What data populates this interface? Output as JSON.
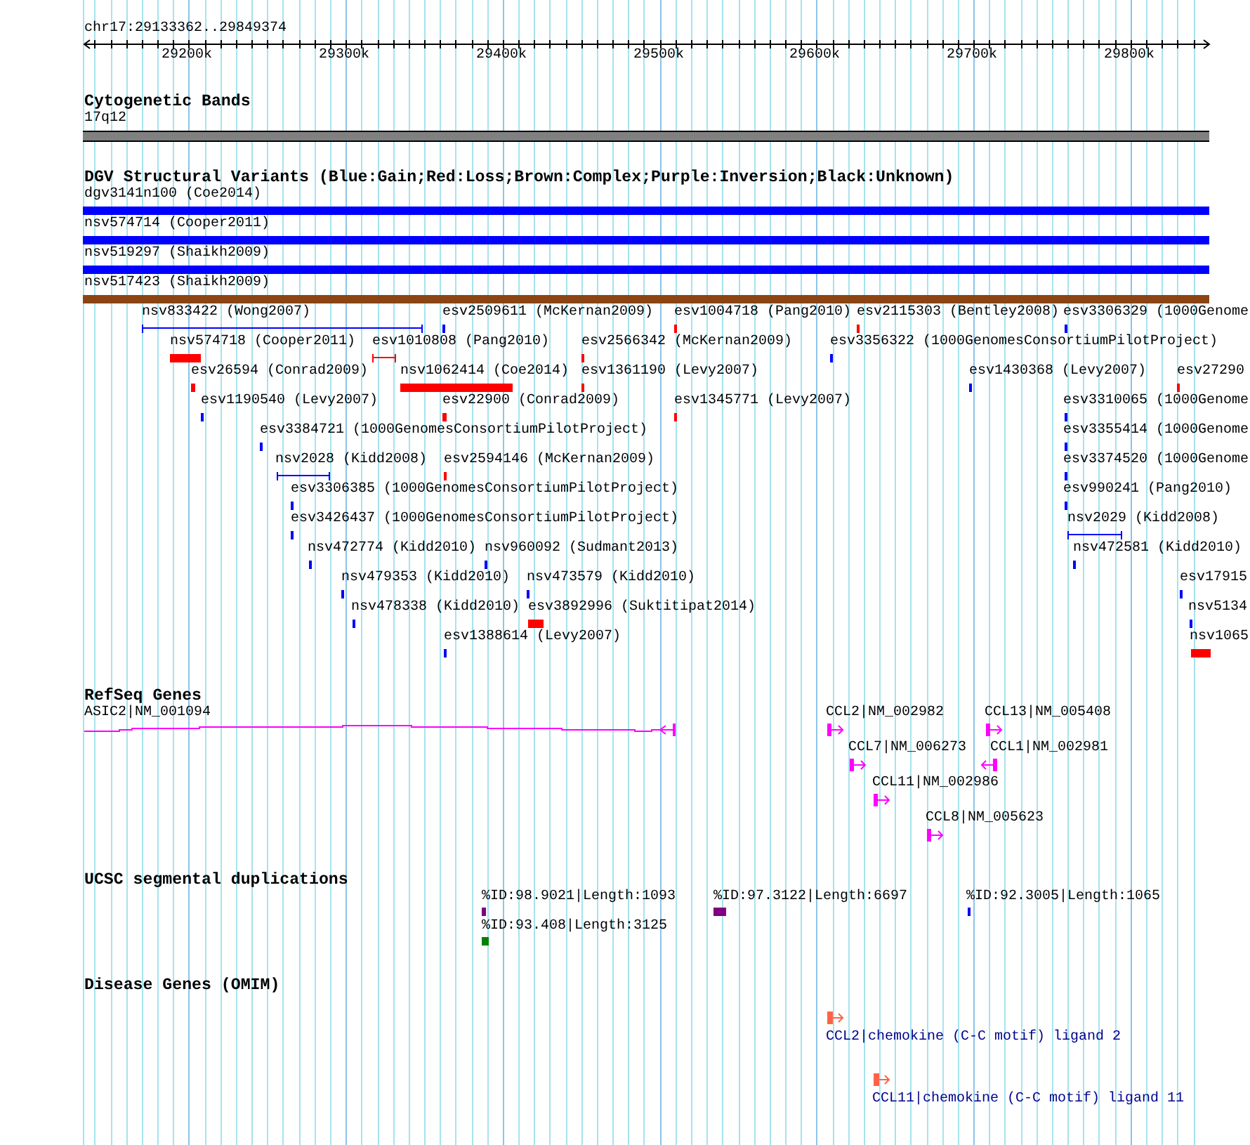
{
  "ruler": {
    "region": "chr17:29133362..29849374",
    "ticks": [
      "29200k",
      "29300k",
      "29400k",
      "29500k",
      "29600k",
      "29700k",
      "29800k"
    ]
  },
  "cytogenetic_bands": {
    "title": "Cytogenetic Bands",
    "bands": [
      {
        "label": "17q12"
      }
    ]
  },
  "structural_variants": {
    "title": "DGV Structural Variants (Blue:Gain;Red:Loss;Brown:Complex;Purple:Inversion;Black:Unknown)",
    "rows": [
      [
        {
          "label": "dgv3141n100 (Coe2014)",
          "kind": "bar",
          "color": "#0000ff"
        }
      ],
      [
        {
          "label": "nsv574714 (Cooper2011)",
          "kind": "bar",
          "color": "#0000ff"
        }
      ],
      [
        {
          "label": "nsv519297 (Shaikh2009)",
          "kind": "bar",
          "color": "#0000ff"
        }
      ],
      [
        {
          "label": "nsv517423 (Shaikh2009)",
          "kind": "bar",
          "color": "#8b4513"
        }
      ],
      [
        {
          "label": "nsv833422 (Wong2007)",
          "kind": "span",
          "color": "#0000ff"
        },
        {
          "label": "esv2509611 (McKernan2009)",
          "kind": "bar",
          "color": "#0000ff"
        },
        {
          "label": "esv1004718 (Pang2010)",
          "kind": "bar",
          "color": "#ff0000"
        },
        {
          "label": "esv2115303 (Bentley2008)",
          "kind": "bar",
          "color": "#ff0000"
        },
        {
          "label": "esv3306329 (1000Genome",
          "kind": "bar",
          "color": "#0000ff"
        }
      ],
      [
        {
          "label": "nsv574718 (Cooper2011)",
          "kind": "bar",
          "color": "#ff0000"
        },
        {
          "label": "esv1010808 (Pang2010)",
          "kind": "span",
          "color": "#ff0000"
        },
        {
          "label": "esv2566342 (McKernan2009)",
          "kind": "bar",
          "color": "#ff0000"
        },
        {
          "label": "esv3356322 (1000GenomesConsortiumPilotProject)",
          "kind": "bar",
          "color": "#0000ff"
        }
      ],
      [
        {
          "label": "esv26594 (Conrad2009)",
          "kind": "bar",
          "color": "#ff0000"
        },
        {
          "label": "nsv1062414 (Coe2014)",
          "kind": "bar",
          "color": "#ff0000"
        },
        {
          "label": "esv1361190 (Levy2007)",
          "kind": "bar",
          "color": "#ff0000"
        },
        {
          "label": "esv1430368 (Levy2007)",
          "kind": "bar",
          "color": "#0000ff"
        },
        {
          "label": "esv27290",
          "kind": "bar",
          "color": "#ff0000"
        }
      ],
      [
        {
          "label": "esv1190540 (Levy2007)",
          "kind": "bar",
          "color": "#0000ff"
        },
        {
          "label": "esv22900 (Conrad2009)",
          "kind": "bar",
          "color": "#ff0000"
        },
        {
          "label": "esv1345771 (Levy2007)",
          "kind": "bar",
          "color": "#ff0000"
        },
        {
          "label": "esv3310065 (1000Genome",
          "kind": "bar",
          "color": "#0000ff"
        }
      ],
      [
        {
          "label": "esv3384721 (1000GenomesConsortiumPilotProject)",
          "kind": "bar",
          "color": "#0000ff"
        },
        {
          "label": "esv3355414 (1000Genome",
          "kind": "bar",
          "color": "#0000ff"
        }
      ],
      [
        {
          "label": "nsv2028 (Kidd2008)",
          "kind": "span",
          "color": "#0000ff"
        },
        {
          "label": "esv2594146 (McKernan2009)",
          "kind": "bar",
          "color": "#ff0000"
        },
        {
          "label": "esv3374520 (1000Genome",
          "kind": "bar",
          "color": "#0000ff"
        }
      ],
      [
        {
          "label": "esv3306385 (1000GenomesConsortiumPilotProject)",
          "kind": "bar",
          "color": "#0000ff"
        },
        {
          "label": "esv990241 (Pang2010)",
          "kind": "bar",
          "color": "#0000ff"
        }
      ],
      [
        {
          "label": "esv3426437 (1000GenomesConsortiumPilotProject)",
          "kind": "bar",
          "color": "#0000ff"
        },
        {
          "label": "nsv2029 (Kidd2008)",
          "kind": "span",
          "color": "#0000ff"
        }
      ],
      [
        {
          "label": "nsv472774 (Kidd2010)",
          "kind": "bar",
          "color": "#0000ff"
        },
        {
          "label": "nsv960092 (Sudmant2013)",
          "kind": "bar",
          "color": "#0000ff"
        },
        {
          "label": "nsv472581 (Kidd2010)",
          "kind": "bar",
          "color": "#0000ff"
        }
      ],
      [
        {
          "label": "nsv479353 (Kidd2010)",
          "kind": "bar",
          "color": "#0000ff"
        },
        {
          "label": "nsv473579 (Kidd2010)",
          "kind": "bar",
          "color": "#0000ff"
        },
        {
          "label": "esv17915",
          "kind": "bar",
          "color": "#0000ff"
        }
      ],
      [
        {
          "label": "nsv478338 (Kidd2010)",
          "kind": "bar",
          "color": "#0000ff"
        },
        {
          "label": "esv3892996 (Suktitipat2014)",
          "kind": "bar",
          "color": "#ff0000"
        },
        {
          "label": "nsv5134",
          "kind": "bar",
          "color": "#0000ff"
        }
      ],
      [
        {
          "label": "esv1388614 (Levy2007)",
          "kind": "bar",
          "color": "#0000ff"
        },
        {
          "label": "nsv1065",
          "kind": "bar",
          "color": "#ff0000"
        }
      ]
    ]
  },
  "refseq_genes": {
    "title": "RefSeq Genes",
    "genes": [
      {
        "label": "ASIC2|NM_001094",
        "kind": "transcript",
        "reverse": true
      },
      {
        "label": "CCL2|NM_002982",
        "kind": "compact",
        "reverse": false
      },
      {
        "label": "CCL13|NM_005408",
        "kind": "compact",
        "reverse": false
      },
      {
        "label": "CCL7|NM_006273",
        "kind": "compact",
        "reverse": false
      },
      {
        "label": "CCL1|NM_002981",
        "kind": "compact",
        "reverse": true
      },
      {
        "label": "CCL11|NM_002986",
        "kind": "compact",
        "reverse": false
      },
      {
        "label": "CCL8|NM_005623",
        "kind": "compact",
        "reverse": false
      }
    ]
  },
  "segmental_duplications": {
    "title": "UCSC segmental duplications",
    "rows": [
      [
        {
          "label": "%ID:98.9021|Length:1093",
          "color": "#800080"
        },
        {
          "label": "%ID:97.3122|Length:6697",
          "color": "#800080"
        },
        {
          "label": "%ID:92.3005|Length:1065",
          "color": "#0000ff"
        }
      ],
      [
        {
          "label": "%ID:93.408|Length:3125",
          "color": "#008000"
        }
      ]
    ]
  },
  "disease_genes": {
    "title": "Disease Genes (OMIM)",
    "genes": [
      {
        "label": "CCL2|chemokine (C-C motif) ligand 2",
        "reverse": false
      },
      {
        "label": "CCL11|chemokine (C-C motif) ligand 11",
        "reverse": false
      }
    ]
  }
}
